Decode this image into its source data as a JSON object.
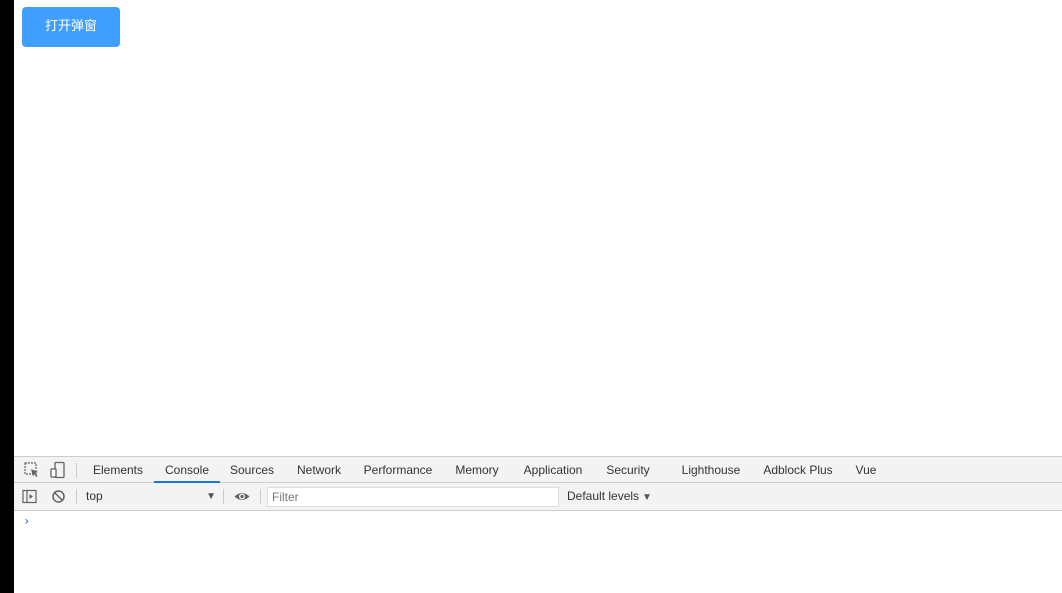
{
  "page": {
    "open_dialog_button": "打开弹窗"
  },
  "devtools": {
    "tabs": [
      {
        "label": "Elements",
        "active": false
      },
      {
        "label": "Console",
        "active": true
      },
      {
        "label": "Sources",
        "active": false
      },
      {
        "label": "Network",
        "active": false
      },
      {
        "label": "Performance",
        "active": false
      },
      {
        "label": "Memory",
        "active": false
      },
      {
        "label": "Application",
        "active": false
      },
      {
        "label": "Security",
        "active": false
      },
      {
        "label": "Lighthouse",
        "active": false
      },
      {
        "label": "Adblock Plus",
        "active": false
      },
      {
        "label": "Vue",
        "active": false
      }
    ],
    "toolbar": {
      "context": "top",
      "filter_placeholder": "Filter",
      "levels": "Default levels"
    },
    "console_prompt": "›"
  },
  "colors": {
    "button_bg": "#409eff",
    "active_tab_underline": "#1a73e8",
    "panel_bg": "#f3f3f3"
  },
  "icons": [
    "inspect-element-icon",
    "device-toolbar-icon",
    "show-sidebar-icon",
    "clear-console-icon",
    "live-expression-eye-icon",
    "dropdown-arrow-icon"
  ]
}
